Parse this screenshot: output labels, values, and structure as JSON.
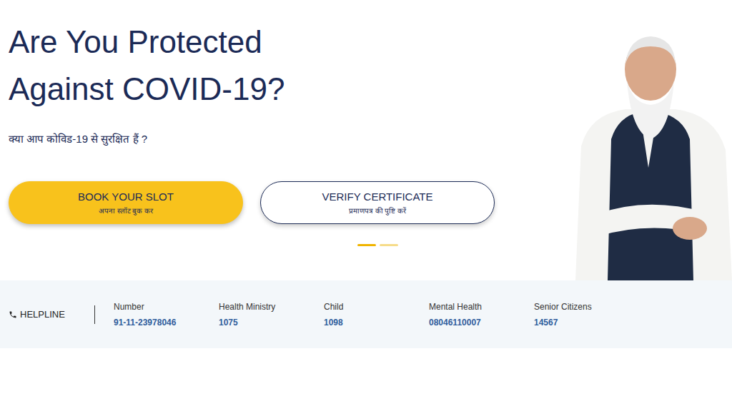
{
  "hero": {
    "title": "Are You Protected Against COVID-19?",
    "subtitle": "क्या आप कोविड-19 से सुरक्षित हैं ?"
  },
  "buttons": [
    {
      "label": "BOOK YOUR SLOT",
      "sublabel": "अपना स्लॉट बुक कर",
      "kind": "primary"
    },
    {
      "label": "VERIFY CERTIFICATE",
      "sublabel": "प्रमाणपत्र की पुष्टि करें",
      "kind": "outline"
    }
  ],
  "carousel": {
    "dots": [
      {
        "selected": true
      },
      {
        "selected": false
      }
    ]
  },
  "helpline": {
    "label": "HELPLINE",
    "items": [
      {
        "label": "Number",
        "value": "91-11-23978046"
      },
      {
        "label": "Health Ministry",
        "value": "1075"
      },
      {
        "label": "Child",
        "value": "1098"
      },
      {
        "label": "Mental Health",
        "value": "08046110007"
      },
      {
        "label": "Senior Citizens",
        "value": "14567"
      }
    ]
  }
}
